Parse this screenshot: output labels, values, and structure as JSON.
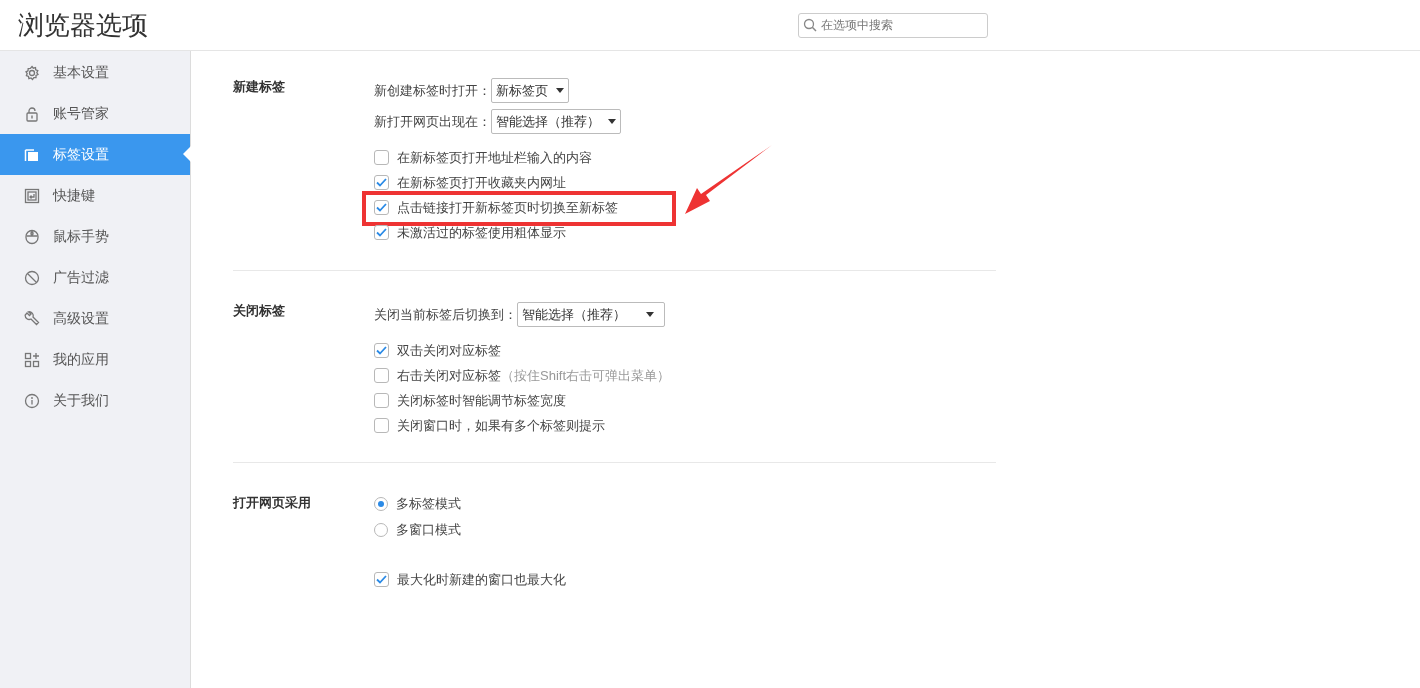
{
  "window": {
    "title": "浏览器选项"
  },
  "search": {
    "placeholder": "在选项中搜索"
  },
  "sidebar": {
    "items": [
      {
        "label": "基本设置",
        "selected": false
      },
      {
        "label": "账号管家",
        "selected": false
      },
      {
        "label": "标签设置",
        "selected": true
      },
      {
        "label": "快捷键",
        "selected": false
      },
      {
        "label": "鼠标手势",
        "selected": false
      },
      {
        "label": "广告过滤",
        "selected": false
      },
      {
        "label": "高级设置",
        "selected": false
      },
      {
        "label": "我的应用",
        "selected": false
      },
      {
        "label": "关于我们",
        "selected": false
      }
    ]
  },
  "sections": [
    {
      "label": "新建标签",
      "selects": [
        {
          "label": "新创建标签时打开：",
          "value": "新标签页"
        },
        {
          "label": "新打开网页出现在：",
          "value": "智能选择（推荐）"
        }
      ],
      "options": [
        {
          "kind": "checkbox",
          "label": "在新标签页打开地址栏输入的内容",
          "checked": false,
          "highlighted": false
        },
        {
          "kind": "checkbox",
          "label": "在新标签页打开收藏夹内网址",
          "checked": true,
          "highlighted": false
        },
        {
          "kind": "checkbox",
          "label": "点击链接打开新标签页时切换至新标签",
          "checked": true,
          "highlighted": true
        },
        {
          "kind": "checkbox",
          "label": "未激活过的标签使用粗体显示",
          "checked": true,
          "highlighted": false
        }
      ]
    },
    {
      "label": "关闭标签",
      "selects": [
        {
          "label": "关闭当前标签后切换到：",
          "value": "智能选择（推荐）"
        }
      ],
      "options": [
        {
          "kind": "checkbox",
          "label": "双击关闭对应标签",
          "checked": true,
          "highlighted": false
        },
        {
          "kind": "checkbox",
          "label": "右击关闭对应标签",
          "hint": "（按住Shift右击可弹出菜单）",
          "checked": false,
          "highlighted": false
        },
        {
          "kind": "checkbox",
          "label": "关闭标签时智能调节标签宽度",
          "checked": false,
          "highlighted": false
        },
        {
          "kind": "checkbox",
          "label": "关闭窗口时，如果有多个标签则提示",
          "checked": false,
          "highlighted": false
        }
      ]
    },
    {
      "label": "打开网页采用",
      "options": [
        {
          "kind": "radio",
          "label": "多标签模式",
          "selected": true,
          "highlighted": false
        },
        {
          "kind": "radio",
          "label": "多窗口模式",
          "selected": false,
          "highlighted": false
        },
        {
          "kind": "spacer"
        },
        {
          "kind": "checkbox",
          "label": "最大化时新建的窗口也最大化",
          "checked": true,
          "highlighted": false
        }
      ]
    }
  ]
}
